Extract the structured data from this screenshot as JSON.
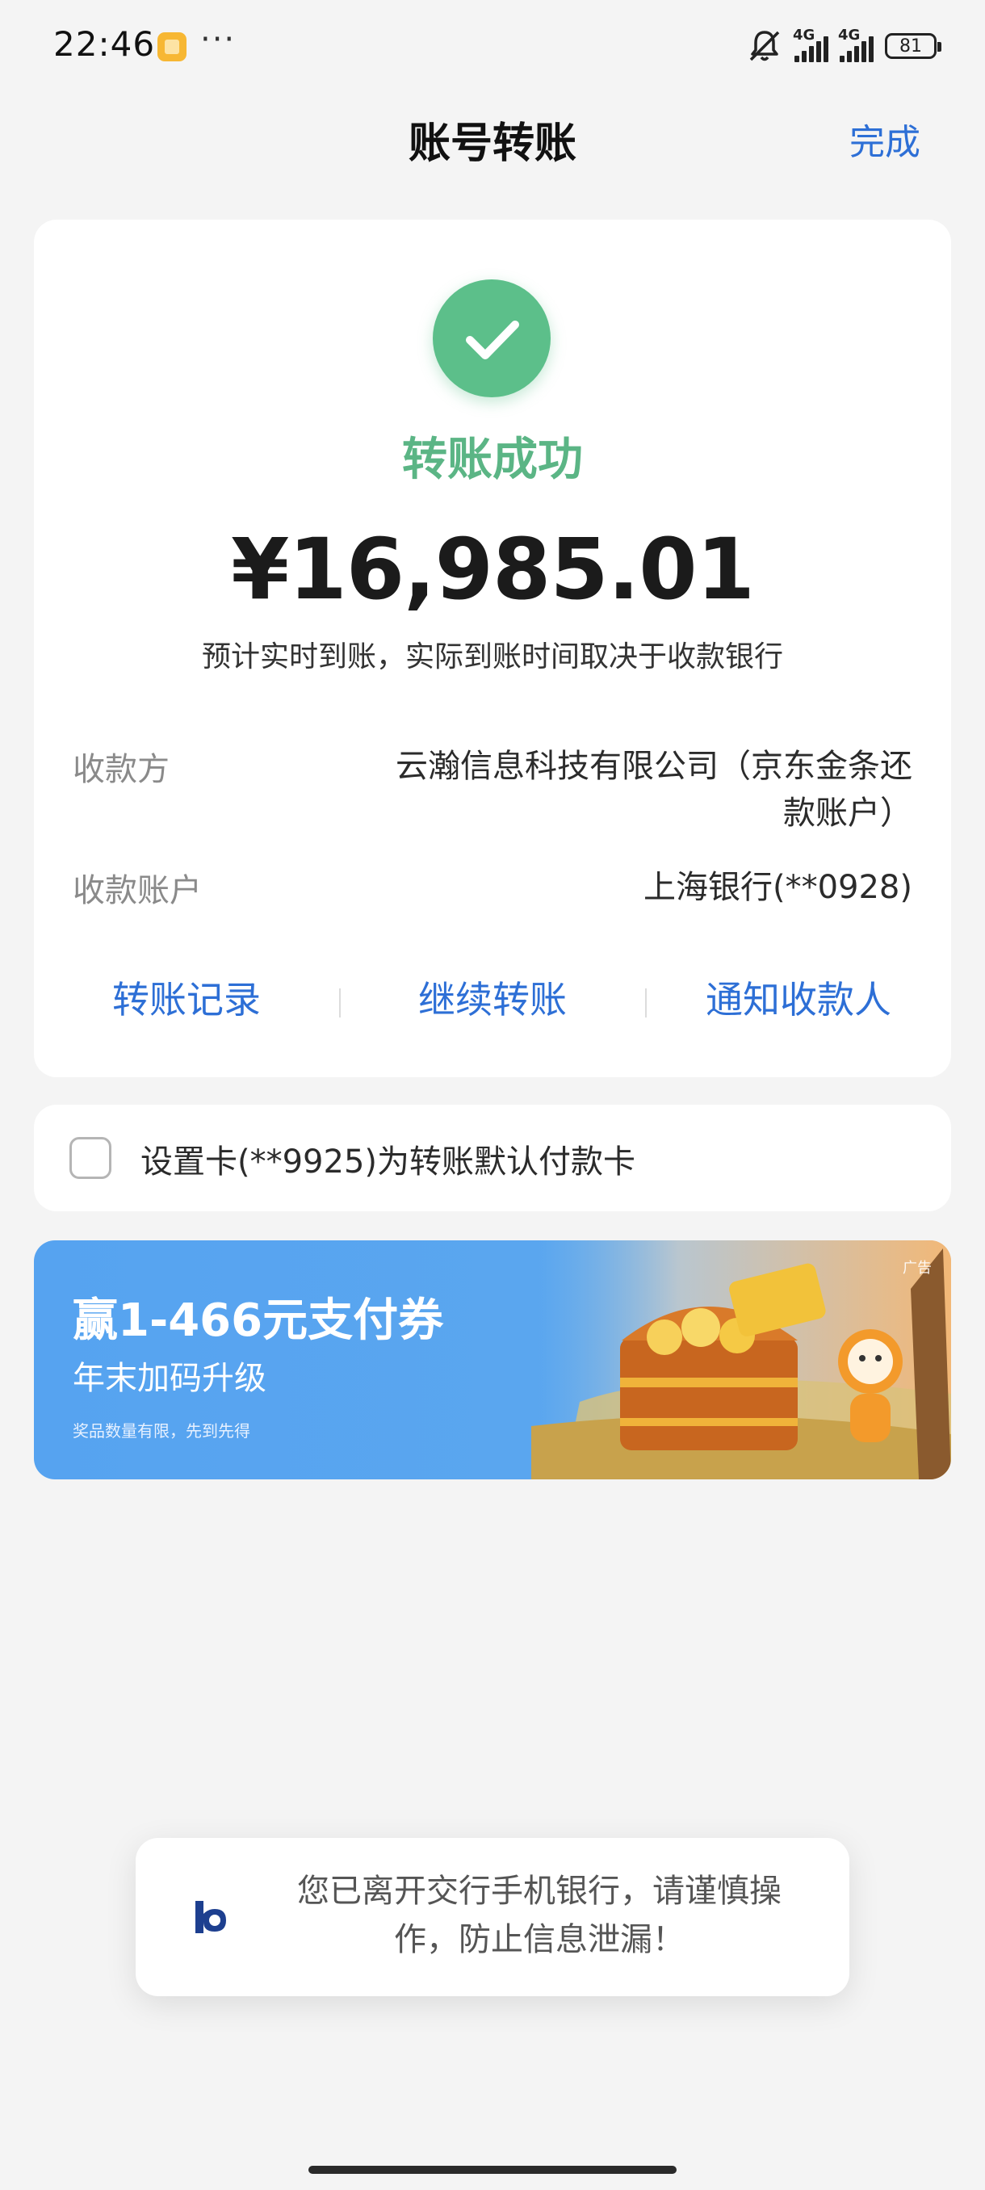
{
  "status_bar": {
    "time": "22:46",
    "more": "···",
    "network1": "4G",
    "network2": "4G",
    "battery": "81"
  },
  "header": {
    "title": "账号转账",
    "done": "完成"
  },
  "result": {
    "status": "转账成功",
    "amount": "¥16,985.01",
    "eta": "预计实时到账，实际到账时间取决于收款银行",
    "payee_label": "收款方",
    "payee_value": "云瀚信息科技有限公司（京东金条还款账户）",
    "account_label": "收款账户",
    "account_value": "上海银行(**0928)",
    "actions": [
      "转账记录",
      "继续转账",
      "通知收款人"
    ]
  },
  "default_card": {
    "label": "设置卡(**9925)为转账默认付款卡"
  },
  "banner": {
    "title": "赢1-466元支付券",
    "subtitle": "年末加码升级",
    "note": "奖品数量有限，先到先得",
    "ad_tag": "广告"
  },
  "toast": {
    "text": "您已离开交行手机银行，请谨慎操作，防止信息泄漏！"
  },
  "colors": {
    "accent": "#2d6fd6",
    "success": "#5cbf8a",
    "banner": "#56a3f0"
  },
  "icons": [
    "check-icon",
    "checkbox-icon",
    "bank-logo-icon",
    "mute-icon",
    "battery-icon",
    "signal-icon"
  ]
}
